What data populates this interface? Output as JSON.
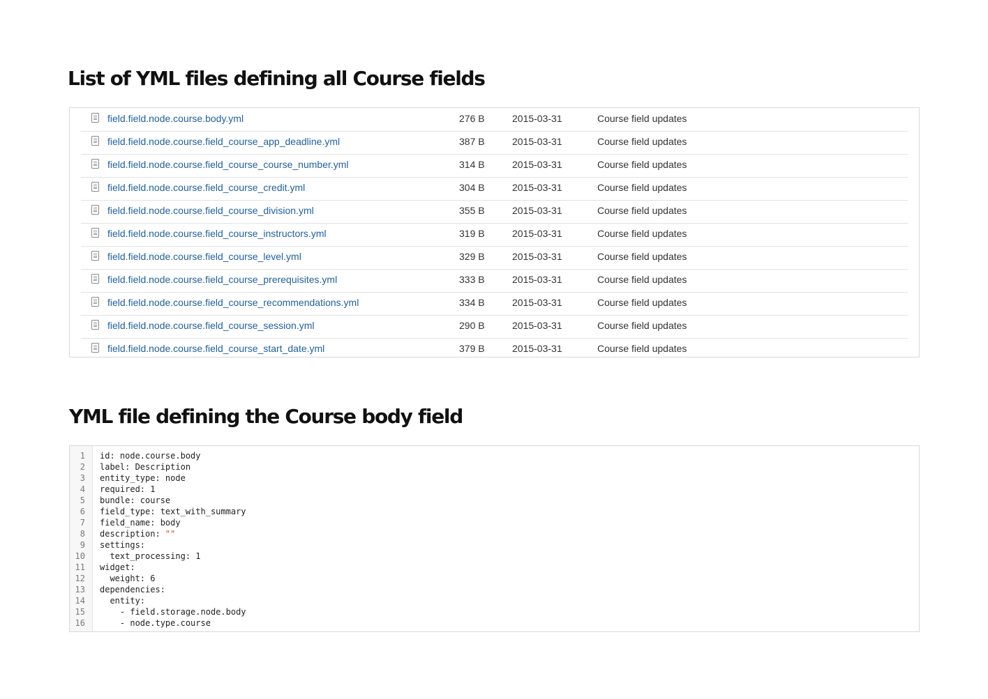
{
  "section_list": {
    "title": "List of YML files defining all Course fields"
  },
  "files": [
    {
      "name": "field.field.node.course.body.yml",
      "size": "276 B",
      "date": "2015-03-31",
      "message": "Course field updates"
    },
    {
      "name": "field.field.node.course.field_course_app_deadline.yml",
      "size": "387 B",
      "date": "2015-03-31",
      "message": "Course field updates"
    },
    {
      "name": "field.field.node.course.field_course_course_number.yml",
      "size": "314 B",
      "date": "2015-03-31",
      "message": "Course field updates"
    },
    {
      "name": "field.field.node.course.field_course_credit.yml",
      "size": "304 B",
      "date": "2015-03-31",
      "message": "Course field updates"
    },
    {
      "name": "field.field.node.course.field_course_division.yml",
      "size": "355 B",
      "date": "2015-03-31",
      "message": "Course field updates"
    },
    {
      "name": "field.field.node.course.field_course_instructors.yml",
      "size": "319 B",
      "date": "2015-03-31",
      "message": "Course field updates"
    },
    {
      "name": "field.field.node.course.field_course_level.yml",
      "size": "329 B",
      "date": "2015-03-31",
      "message": "Course field updates"
    },
    {
      "name": "field.field.node.course.field_course_prerequisites.yml",
      "size": "333 B",
      "date": "2015-03-31",
      "message": "Course field updates"
    },
    {
      "name": "field.field.node.course.field_course_recommendations.yml",
      "size": "334 B",
      "date": "2015-03-31",
      "message": "Course field updates"
    },
    {
      "name": "field.field.node.course.field_course_session.yml",
      "size": "290 B",
      "date": "2015-03-31",
      "message": "Course field updates"
    },
    {
      "name": "field.field.node.course.field_course_start_date.yml",
      "size": "379 B",
      "date": "2015-03-31",
      "message": "Course field updates"
    }
  ],
  "file_icon": "file-document-icon",
  "section_code": {
    "title": "YML file defining the Course body field"
  },
  "code_lines": [
    {
      "number": "1",
      "text": "id: node.course.body"
    },
    {
      "number": "2",
      "text": "label: Description"
    },
    {
      "number": "3",
      "text": "entity_type: node"
    },
    {
      "number": "4",
      "text": "required: 1"
    },
    {
      "number": "5",
      "text": "bundle: course"
    },
    {
      "number": "6",
      "text": "field_type: text_with_summary"
    },
    {
      "number": "7",
      "text": "field_name: body"
    },
    {
      "number": "8",
      "text": "description: ",
      "string": "\"\""
    },
    {
      "number": "9",
      "text": "settings:"
    },
    {
      "number": "10",
      "text": "  text_processing: 1"
    },
    {
      "number": "11",
      "text": "widget:"
    },
    {
      "number": "12",
      "text": "  weight: 6"
    },
    {
      "number": "13",
      "text": "dependencies:"
    },
    {
      "number": "14",
      "text": "  entity:"
    },
    {
      "number": "15",
      "text": "    - field.storage.node.body"
    },
    {
      "number": "16",
      "text": "    - node.type.course"
    }
  ],
  "colors": {
    "link": "#1f5f9e",
    "string_literal": "#d14b00",
    "border": "#d8d8d8"
  }
}
